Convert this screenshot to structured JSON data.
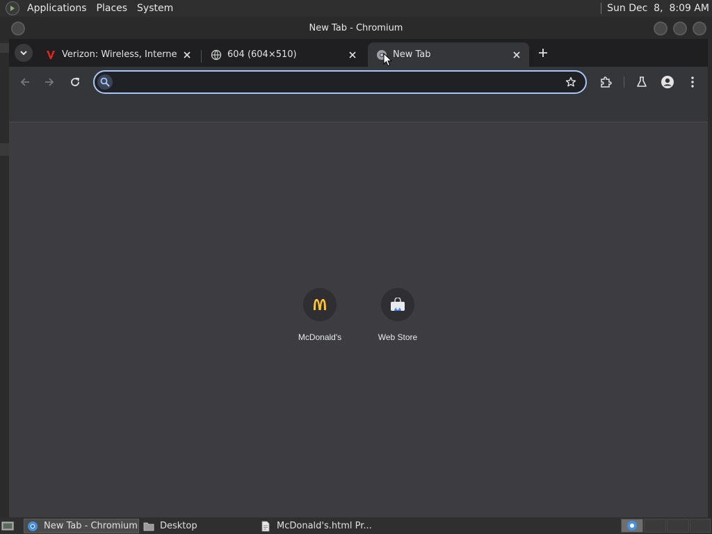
{
  "topbar": {
    "menus": [
      "Applications",
      "Places",
      "System"
    ],
    "clock": "Sun Dec  8,  8:09 AM"
  },
  "window": {
    "title": "New Tab - Chromium"
  },
  "tabs": [
    {
      "title": "Verizon: Wireless, Internet, TV",
      "favicon": "verizon-v-icon",
      "active": false
    },
    {
      "title": "604 (604×510)",
      "favicon": "globe-icon",
      "active": false
    },
    {
      "title": "New Tab",
      "favicon": "chromium-icon",
      "active": true
    }
  ],
  "omnibox": {
    "value": "",
    "placeholder": ""
  },
  "shortcuts": [
    {
      "label": "McDonald's",
      "icon": "mcdonalds-logo-icon"
    },
    {
      "label": "Web Store",
      "icon": "web-store-icon"
    }
  ],
  "taskbar": {
    "items": [
      {
        "label": "New Tab - Chromium",
        "icon": "chromium-icon",
        "active": true
      },
      {
        "label": "Desktop",
        "icon": "folder-icon",
        "active": false
      },
      {
        "label": "McDonald's.html Pr...",
        "icon": "document-icon",
        "active": false
      }
    ]
  },
  "colors": {
    "accent": "#a8c7fa",
    "ntp_background": "#3c3c41",
    "toolbar": "#35363a",
    "mcdonalds_yellow": "#ffc72c"
  }
}
